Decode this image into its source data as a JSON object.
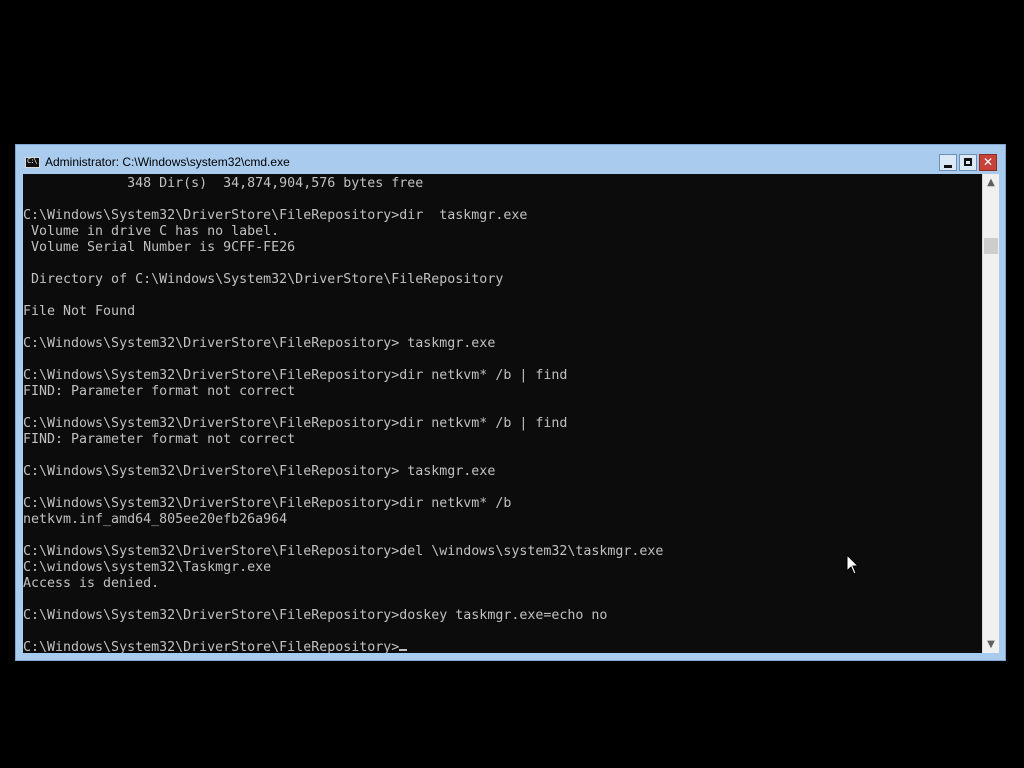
{
  "window": {
    "title": "Administrator: C:\\Windows\\system32\\cmd.exe",
    "icon": "console-app-icon",
    "icon_glyph": "C:\\"
  },
  "title_buttons": {
    "minimize": "minimize-icon",
    "maximize": "maximize-icon",
    "close": "close-icon",
    "close_glyph": "✕"
  },
  "console": {
    "lines": [
      "             348 Dir(s)  34,874,904,576 bytes free",
      "",
      "C:\\Windows\\System32\\DriverStore\\FileRepository>dir  taskmgr.exe",
      " Volume in drive C has no label.",
      " Volume Serial Number is 9CFF-FE26",
      "",
      " Directory of C:\\Windows\\System32\\DriverStore\\FileRepository",
      "",
      "File Not Found",
      "",
      "C:\\Windows\\System32\\DriverStore\\FileRepository> taskmgr.exe",
      "",
      "C:\\Windows\\System32\\DriverStore\\FileRepository>dir netkvm* /b | find",
      "FIND: Parameter format not correct",
      "",
      "C:\\Windows\\System32\\DriverStore\\FileRepository>dir netkvm* /b | find",
      "FIND: Parameter format not correct",
      "",
      "C:\\Windows\\System32\\DriverStore\\FileRepository> taskmgr.exe",
      "",
      "C:\\Windows\\System32\\DriverStore\\FileRepository>dir netkvm* /b",
      "netkvm.inf_amd64_805ee20efb26a964",
      "",
      "C:\\Windows\\System32\\DriverStore\\FileRepository>del \\windows\\system32\\taskmgr.exe",
      "C:\\windows\\system32\\Taskmgr.exe",
      "Access is denied.",
      "",
      "C:\\Windows\\System32\\DriverStore\\FileRepository>doskey taskmgr.exe=echo no",
      ""
    ],
    "prompt": "C:\\Windows\\System32\\DriverStore\\FileRepository>"
  },
  "scrollbar": {
    "up_arrow": "▲",
    "down_arrow": "▼",
    "position": 0.11
  },
  "colors": {
    "console_bg": "#0c0c0c",
    "console_fg": "#c0c0c0",
    "titlebar": "#a9cbee",
    "close_button": "#c7433a"
  }
}
